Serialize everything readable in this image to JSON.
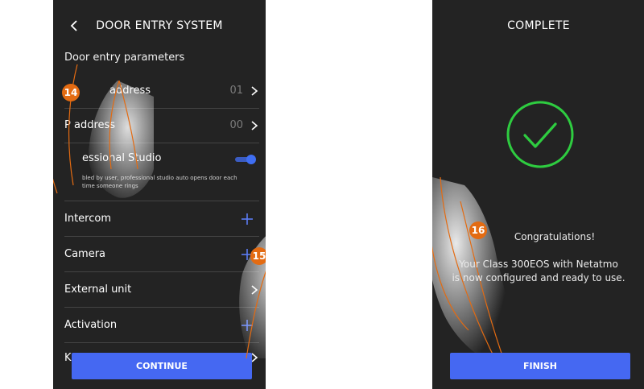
{
  "left_screen": {
    "header": {
      "title": "DOOR ENTRY SYSTEM",
      "back_icon": "chevron-left-icon"
    },
    "section_title": "Door entry parameters",
    "rows": [
      {
        "label": "address",
        "value": "01"
      },
      {
        "label": "P address",
        "value": "00"
      }
    ],
    "professional_studio": {
      "label": "essional Studio",
      "enabled": true,
      "description": "bled by user, professional studio auto opens door each time someone rings"
    },
    "menu": [
      {
        "label": "Intercom",
        "icon": "plus-icon"
      },
      {
        "label": "Camera",
        "icon": "plus-icon"
      },
      {
        "label": "External unit",
        "icon": "chevron-right-icon"
      },
      {
        "label": "Activation",
        "icon": "plus-icon"
      },
      {
        "label": "K",
        "icon": "chevron-right-icon"
      }
    ],
    "continue_label": "CONTINUE",
    "step_badges": [
      "14",
      "15"
    ]
  },
  "right_screen": {
    "header": {
      "title": "COMPLETE"
    },
    "check_icon": "check-circle-icon",
    "step_badge": "16",
    "congrats": "Congratulations!",
    "message_line1": "Your Class 300EOS with Netatmo",
    "message_line2": "is now configured and ready to use.",
    "finish_label": "FINISH"
  },
  "colors": {
    "accent": "#4568f2",
    "badge": "#e36b12",
    "check": "#2ecc40",
    "background": "#232323"
  }
}
